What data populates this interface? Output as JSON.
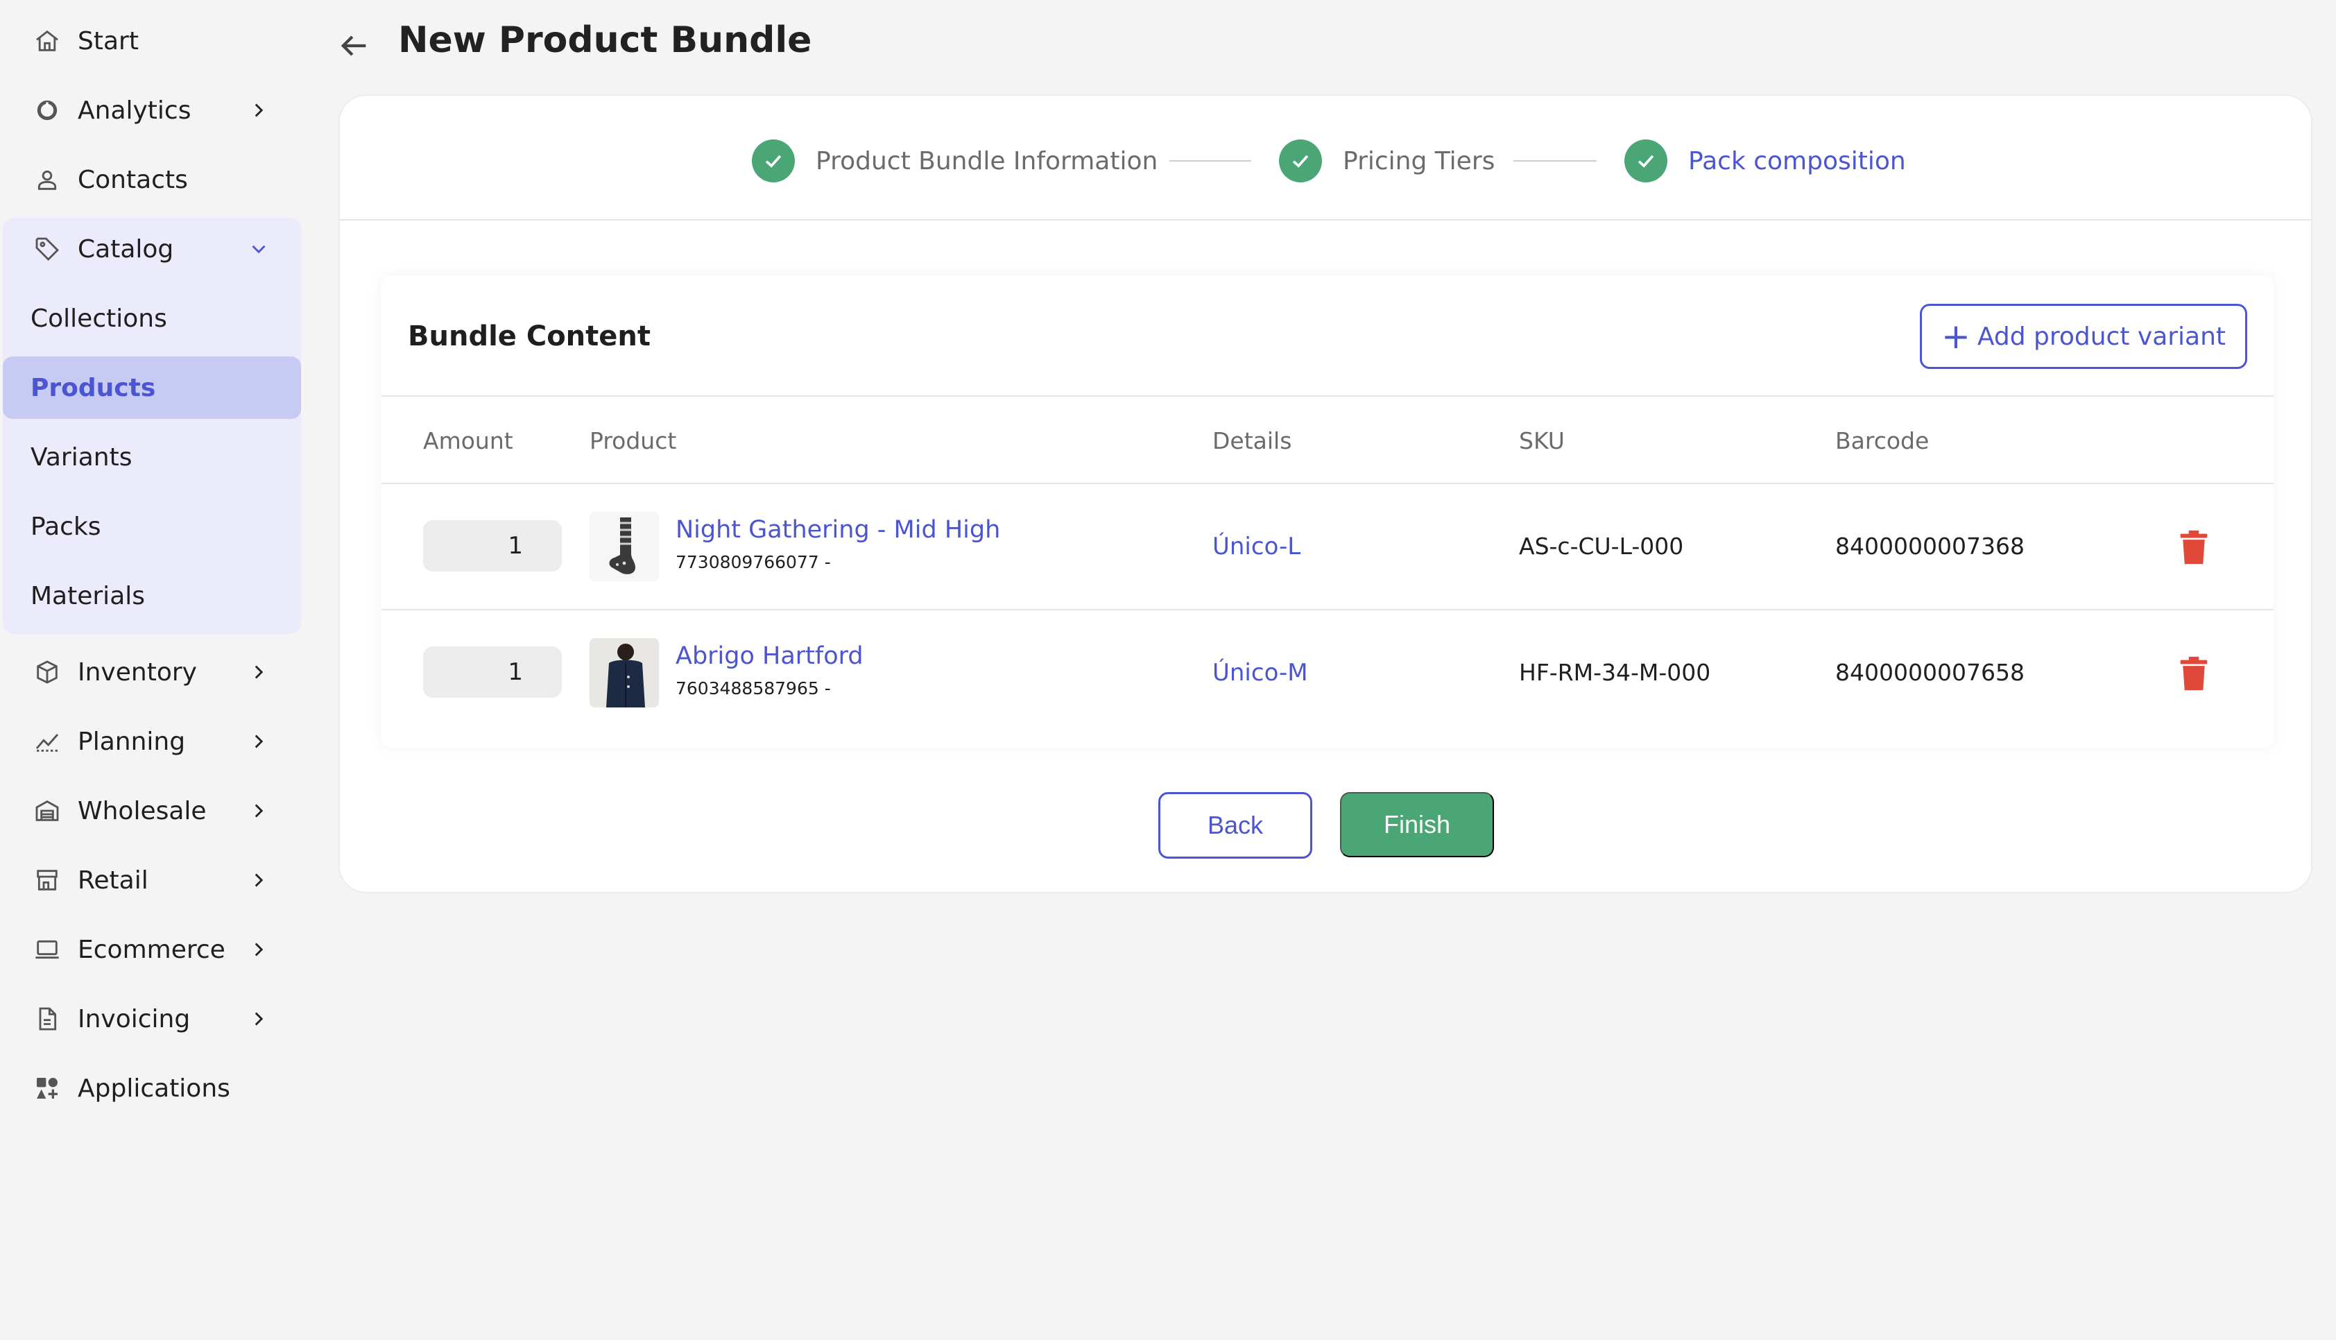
{
  "header": {
    "title": "New Product Bundle"
  },
  "sidebar": {
    "items": [
      {
        "label": "Start",
        "icon": "home-icon"
      },
      {
        "label": "Analytics",
        "icon": "chart-pie-icon"
      },
      {
        "label": "Contacts",
        "icon": "user-icon"
      },
      {
        "label": "Catalog",
        "icon": "tag-icon",
        "expanded": true
      },
      {
        "label": "Inventory",
        "icon": "box-icon"
      },
      {
        "label": "Planning",
        "icon": "trend-icon"
      },
      {
        "label": "Wholesale",
        "icon": "warehouse-icon"
      },
      {
        "label": "Retail",
        "icon": "store-icon"
      },
      {
        "label": "Ecommerce",
        "icon": "laptop-icon"
      },
      {
        "label": "Invoicing",
        "icon": "document-icon"
      },
      {
        "label": "Applications",
        "icon": "apps-icon"
      }
    ],
    "catalog_sub": [
      {
        "label": "Collections"
      },
      {
        "label": "Products",
        "active": true
      },
      {
        "label": "Variants"
      },
      {
        "label": "Packs"
      },
      {
        "label": "Materials"
      }
    ]
  },
  "stepper": {
    "steps": [
      {
        "label": "Product Bundle Information",
        "done": true
      },
      {
        "label": "Pricing Tiers",
        "done": true
      },
      {
        "label": "Pack composition",
        "done": true,
        "current": true
      }
    ]
  },
  "bundle": {
    "title": "Bundle Content",
    "add_button": "Add product variant",
    "columns": [
      "Amount",
      "Product",
      "Details",
      "SKU",
      "Barcode"
    ],
    "rows": [
      {
        "amount": "1",
        "product": "Night Gathering - Mid High",
        "code": "7730809766077 -",
        "details": "Único-L",
        "sku": "AS-c-CU-L-000",
        "barcode": "8400000007368",
        "thumb": "sock"
      },
      {
        "amount": "1",
        "product": "Abrigo Hartford",
        "code": "7603488587965 -",
        "details": "Único-M",
        "sku": "HF-RM-34-M-000",
        "barcode": "8400000007658",
        "thumb": "coat"
      }
    ]
  },
  "actions": {
    "back": "Back",
    "finish": "Finish"
  },
  "colors": {
    "accent": "#4b55d1",
    "success": "#4aa775",
    "danger": "#e0493a",
    "sidebar_group": "#ebebfb",
    "sidebar_active": "#c7cbf3"
  }
}
